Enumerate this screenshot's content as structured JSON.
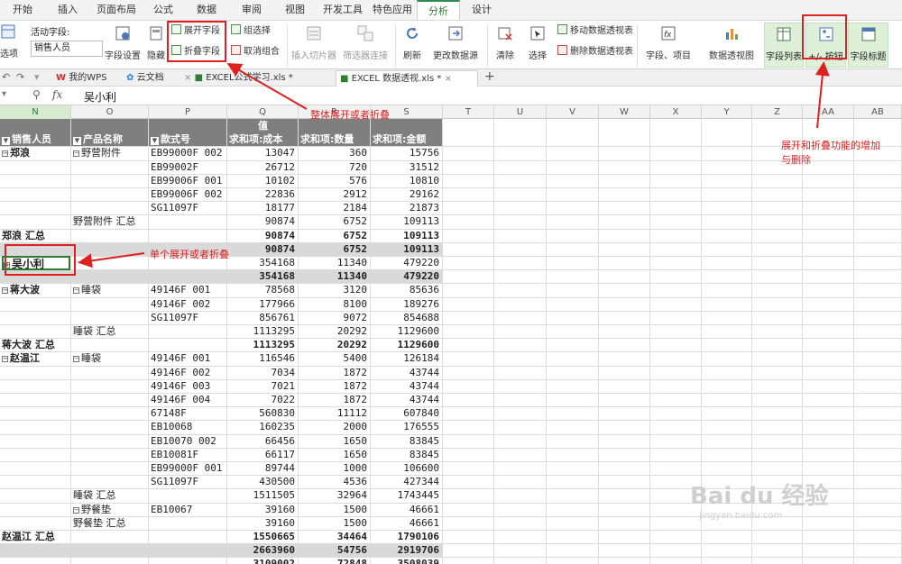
{
  "menu": {
    "tabs": [
      "开始",
      "插入",
      "页面布局",
      "公式",
      "数据",
      "审阅",
      "视图",
      "开发工具",
      "特色应用",
      "分析",
      "设计"
    ],
    "active": "分析"
  },
  "ribbon": {
    "options_label": "选项",
    "active_field_label": "活动字段:",
    "active_field_value": "销售人员",
    "field_settings": "字段设置",
    "hide": "隐藏",
    "expand_field": "展开字段",
    "collapse_field": "折叠字段",
    "group_selection": "组选择",
    "ungroup": "取消组合",
    "insert_slicer": "插入切片器",
    "filter_connections": "筛选器连接",
    "refresh": "刷新",
    "change_source": "更改数据源",
    "clear": "清除",
    "select": "选择",
    "move_pivot": "移动数据透视表",
    "delete_pivot": "删除数据透视表",
    "fields_items": "字段、项目",
    "pivot_chart": "数据透视图",
    "field_list": "字段列表",
    "plus_minus_buttons": "+/- 按钮",
    "field_headers": "字段标题"
  },
  "tabs_row": {
    "my_wps": "我的WPS",
    "cloud_docs": "云文档",
    "doc1": "EXCEL公式学习.xls *",
    "doc2": "EXCEL 数据透视.xls *"
  },
  "formula_bar": {
    "fx_label": "fx",
    "value": "吴小利"
  },
  "columns": [
    "N",
    "O",
    "P",
    "Q",
    "R",
    "S",
    "T",
    "U",
    "V",
    "W",
    "X",
    "Y",
    "Z",
    "AA",
    "AB"
  ],
  "pivot": {
    "values_header": "值",
    "headers": [
      "销售人员",
      "产品名称",
      "款式号",
      "求和项:成本",
      "求和项:数量",
      "求和项:金额"
    ],
    "rows": [
      {
        "a": "郑浪",
        "b": "野营附件",
        "c": "EB99000F 002",
        "q": "13047",
        "r": "360",
        "s": "15756",
        "ta": 1,
        "tb": 1
      },
      {
        "c": "EB99002F",
        "q": "26712",
        "r": "720",
        "s": "31512"
      },
      {
        "c": "EB99006F 001",
        "q": "10102",
        "r": "576",
        "s": "10810"
      },
      {
        "c": "EB99006F 002",
        "q": "22836",
        "r": "2912",
        "s": "29162"
      },
      {
        "c": "SG11097F",
        "q": "18177",
        "r": "2184",
        "s": "21873"
      },
      {
        "b": "野营附件 汇总",
        "q": "90874",
        "r": "6752",
        "s": "109113"
      },
      {
        "a": "郑浪 汇总",
        "q": "90874",
        "r": "6752",
        "s": "109113",
        "bold": 1
      },
      {
        "q": "90874",
        "r": "6752",
        "s": "109113",
        "gray": 1,
        "bold": 1
      },
      {
        "a": "吴小利",
        "q": "354168",
        "r": "11340",
        "s": "479220",
        "ta": 2,
        "sel": 1
      },
      {
        "q": "354168",
        "r": "11340",
        "s": "479220",
        "gray": 1,
        "bold": 1
      },
      {
        "a": "蒋大波",
        "b": "睡袋",
        "c": "49146F 001",
        "q": "78568",
        "r": "3120",
        "s": "85636",
        "ta": 1,
        "tb": 1
      },
      {
        "c": "49146F 002",
        "q": "177966",
        "r": "8100",
        "s": "189276"
      },
      {
        "c": "SG11097F",
        "q": "856761",
        "r": "9072",
        "s": "854688"
      },
      {
        "b": "睡袋 汇总",
        "q": "1113295",
        "r": "20292",
        "s": "1129600"
      },
      {
        "a": "蒋大波 汇总",
        "q": "1113295",
        "r": "20292",
        "s": "1129600",
        "bold": 1
      },
      {
        "a": "赵温江",
        "b": "睡袋",
        "c": "49146F 001",
        "q": "116546",
        "r": "5400",
        "s": "126184",
        "ta": 1,
        "tb": 1
      },
      {
        "c": "49146F 002",
        "q": "7034",
        "r": "1872",
        "s": "43744"
      },
      {
        "c": "49146F 003",
        "q": "7021",
        "r": "1872",
        "s": "43744"
      },
      {
        "c": "49146F 004",
        "q": "7022",
        "r": "1872",
        "s": "43744"
      },
      {
        "c": "67148F",
        "q": "560830",
        "r": "11112",
        "s": "607840"
      },
      {
        "c": "EB10068",
        "q": "160235",
        "r": "2000",
        "s": "176555"
      },
      {
        "c": "EB10070 002",
        "q": "66456",
        "r": "1650",
        "s": "83845"
      },
      {
        "c": "EB10081F",
        "q": "66117",
        "r": "1650",
        "s": "83845"
      },
      {
        "c": "EB99000F 001",
        "q": "89744",
        "r": "1000",
        "s": "106600"
      },
      {
        "c": "SG11097F",
        "q": "430500",
        "r": "4536",
        "s": "427344"
      },
      {
        "b": "睡袋 汇总",
        "q": "1511505",
        "r": "32964",
        "s": "1743445"
      },
      {
        "b": "野餐垫",
        "c": "EB10067",
        "q": "39160",
        "r": "1500",
        "s": "46661",
        "tb": 1
      },
      {
        "b": "野餐垫 汇总",
        "q": "39160",
        "r": "1500",
        "s": "46661"
      },
      {
        "a": "赵温江 汇总",
        "q": "1550665",
        "r": "34464",
        "s": "1790106",
        "bold": 1
      },
      {
        "q": "2663960",
        "r": "54756",
        "s": "2919706",
        "gray": 1,
        "bold": 1
      },
      {
        "q": "3109002",
        "r": "72848",
        "s": "3508039",
        "bold": 1
      }
    ]
  },
  "annotations": {
    "collapse_all": "整体展开或者折叠",
    "single": "单个展开或者折叠",
    "buttons_note_1": "展开和折叠功能的增加",
    "buttons_note_2": "与删除"
  },
  "watermark": {
    "main": "Bai du 经验",
    "sub": "jingyan.baidu.com"
  },
  "colors": {
    "accent_green": "#2e7d32",
    "annotation_red": "#e02020",
    "header_gray": "#7f7f7f"
  }
}
